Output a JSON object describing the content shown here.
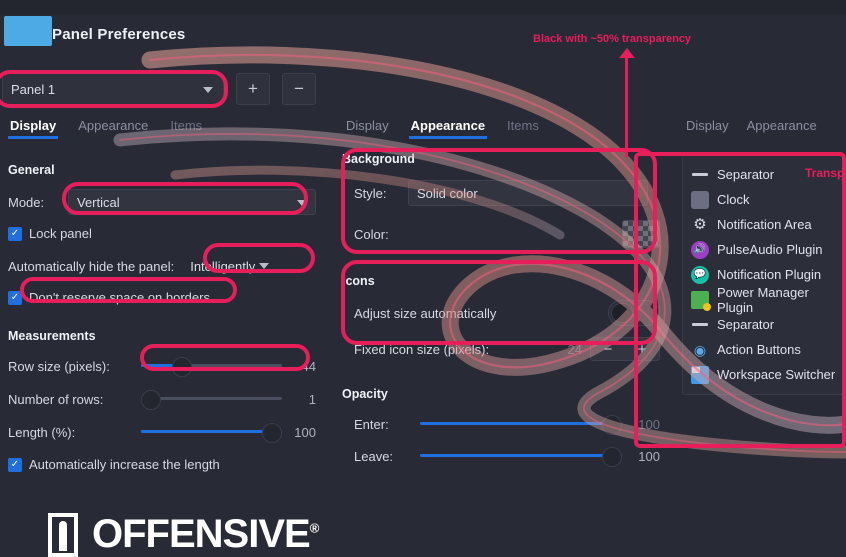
{
  "window": {
    "title": "Panel Preferences",
    "app_icon": "panel-icon"
  },
  "panel_selector": {
    "value": "Panel 1",
    "add_label": "+",
    "remove_label": "−"
  },
  "colors": {
    "background": "#282a36",
    "card": "#2c2e3a",
    "accent_blue": "#1f6fe0",
    "annotation_pink": "#e61e5a",
    "app_icon_blue": "#4eaae4",
    "text": "#e8e9ef",
    "muted_text": "#8b90a0"
  },
  "left_panel": {
    "tabs": [
      {
        "label": "Display",
        "active": true
      },
      {
        "label": "Appearance",
        "active": false
      },
      {
        "label": "Items",
        "active": false
      }
    ],
    "general": {
      "heading": "General",
      "mode_label": "Mode:",
      "mode_value": "Vertical",
      "lock_panel_label": "Lock panel",
      "lock_panel_checked": true,
      "autohide_label": "Automatically hide the panel:",
      "autohide_value": "Intelligently",
      "reserve_label": "Don't reserve space on borders",
      "reserve_checked": true
    },
    "measurements": {
      "heading": "Measurements",
      "rows": [
        {
          "label": "Row size (pixels):",
          "value": "44",
          "percent": 26
        },
        {
          "label": "Number of rows:",
          "value": "1",
          "percent": 0
        },
        {
          "label": "Length (%):",
          "value": "100",
          "percent": 100
        }
      ],
      "autoincrease_label": "Automatically increase the length",
      "autoincrease_checked": true
    }
  },
  "middle_panel": {
    "tabs": [
      {
        "label": "Display",
        "active": false
      },
      {
        "label": "Appearance",
        "active": true
      },
      {
        "label": "Items",
        "active": false
      }
    ],
    "background": {
      "heading": "Background",
      "style_label": "Style:",
      "style_value": "Solid color",
      "color_label": "Color:",
      "color_swatch": "transparent-checkerboard"
    },
    "icons": {
      "heading": "Icons",
      "adjust_label": "Adjust size automatically",
      "adjust_enabled": false,
      "fixed_size_label": "Fixed icon size (pixels):",
      "fixed_size_value": "24",
      "decrement_label": "−",
      "increment_label": "+"
    },
    "opacity": {
      "heading": "Opacity",
      "rows": [
        {
          "label": "Enter:",
          "value": "100",
          "percent": 100
        },
        {
          "label": "Leave:",
          "value": "100",
          "percent": 100
        }
      ]
    }
  },
  "right_panel": {
    "tabs": [
      {
        "label": "Display",
        "active": false
      },
      {
        "label": "Appearance",
        "active": false
      }
    ],
    "items": [
      {
        "label": "Separator",
        "icon": "separator-icon"
      },
      {
        "label": "Clock",
        "icon": "clock-icon"
      },
      {
        "label": "Notification Area",
        "icon": "notification-area-icon"
      },
      {
        "label": "PulseAudio Plugin",
        "icon": "pulseaudio-icon"
      },
      {
        "label": "Notification Plugin",
        "icon": "notification-plugin-icon"
      },
      {
        "label": "Power Manager Plugin",
        "icon": "power-manager-icon"
      },
      {
        "label": "Separator",
        "icon": "separator-icon"
      },
      {
        "label": "Action Buttons",
        "icon": "action-buttons-icon"
      },
      {
        "label": "Workspace Switcher",
        "icon": "workspace-switcher-icon"
      }
    ]
  },
  "annotations": {
    "transparency_note": "Black with ~50% transparency",
    "right_edge_note": "Transp"
  },
  "branding": {
    "name": "OFFENSIVE",
    "registered": "®"
  }
}
